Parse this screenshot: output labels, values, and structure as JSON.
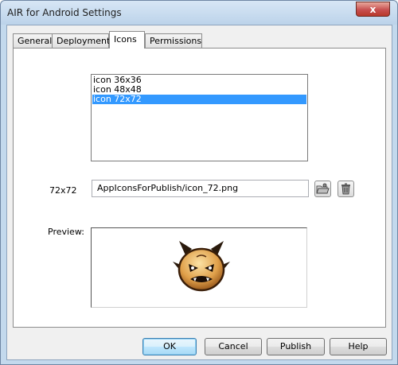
{
  "window": {
    "title": "AIR for Android Settings",
    "close_glyph": "x"
  },
  "tabs": [
    {
      "label": "General",
      "active": false
    },
    {
      "label": "Deployment",
      "active": false
    },
    {
      "label": "Icons",
      "active": true
    },
    {
      "label": "Permissions",
      "active": false
    }
  ],
  "icons_list": {
    "items": [
      "icon 36x36",
      "icon 48x48",
      "icon 72x72"
    ],
    "selected": "icon 72x72"
  },
  "icon_path": {
    "label": "72x72",
    "value": "AppIconsForPublish/icon_72.png",
    "browse_icon": "folder-browse-icon",
    "delete_icon": "trash-icon"
  },
  "preview": {
    "label": "Preview:"
  },
  "buttons": {
    "ok": "OK",
    "cancel": "Cancel",
    "publish": "Publish",
    "help": "Help"
  },
  "colors": {
    "selection": "#3399ff",
    "title_bar": "#c3d9ed",
    "close": "#c75050"
  }
}
